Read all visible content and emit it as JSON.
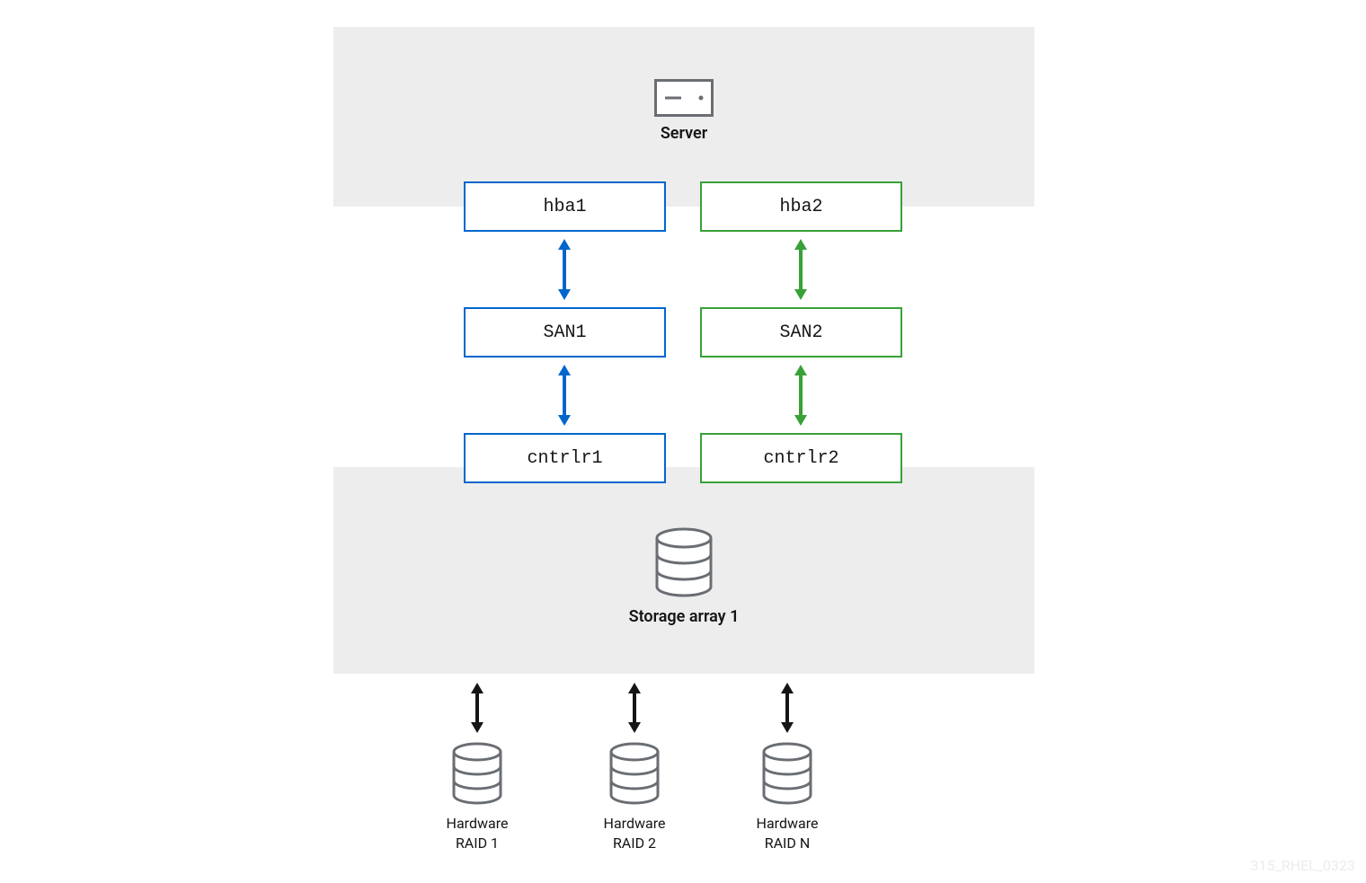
{
  "server": {
    "label": "Server"
  },
  "nodes": {
    "hba1": "hba1",
    "hba2": "hba2",
    "san1": "SAN1",
    "san2": "SAN2",
    "cntrlr1": "cntrlr1",
    "cntrlr2": "cntrlr2"
  },
  "storage": {
    "label": "Storage array 1"
  },
  "raid": {
    "r1": {
      "line1": "Hardware",
      "line2": "RAID 1"
    },
    "r2": {
      "line1": "Hardware",
      "line2": "RAID 2"
    },
    "rN": {
      "line1": "Hardware",
      "line2": "RAID N"
    }
  },
  "colors": {
    "blue": "#0066cc",
    "green": "#38a138",
    "black": "#151515",
    "gray": "#6a6e73"
  },
  "watermark": "315_RHEL_0323"
}
